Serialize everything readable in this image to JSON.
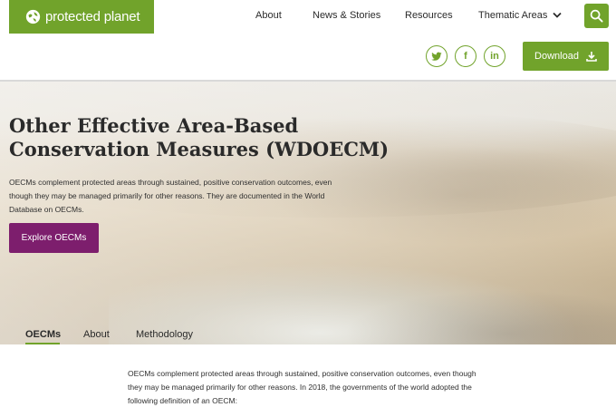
{
  "header": {
    "logo_text": "protected planet",
    "logo_icon": "globe-leaf-icon",
    "nav": [
      {
        "label": "About"
      },
      {
        "label": "News & Stories"
      },
      {
        "label": "Resources"
      },
      {
        "label": "Thematic Areas",
        "icon": "chevron-down-icon"
      }
    ],
    "search_icon": "search-icon",
    "social": [
      {
        "name": "twitter",
        "glyph": "t"
      },
      {
        "name": "facebook",
        "glyph": "f"
      },
      {
        "name": "linkedin",
        "glyph": "in"
      }
    ],
    "download_label": "Download",
    "download_icon": "download-icon",
    "accent_color": "#71a32b"
  },
  "hero": {
    "title": "Other Effective Area-Based Conservation Measures (WDOECM)",
    "description": "OECMs complement protected areas through sustained, positive conservation outcomes, even though they may be managed primarily for other reasons. They are documented in the World Database on OECMs.",
    "cta_label": "Explore OECMs",
    "cta_color": "#7d1e6d"
  },
  "tabs": [
    {
      "label": "OECMs",
      "active": true
    },
    {
      "label": "About",
      "active": false
    },
    {
      "label": "Methodology",
      "active": false
    }
  ],
  "content": {
    "intro": "OECMs complement protected areas through sustained, positive conservation outcomes, even though they may be managed primarily for other reasons. In 2018, the governments of the world adopted the following definition of an OECM:"
  }
}
